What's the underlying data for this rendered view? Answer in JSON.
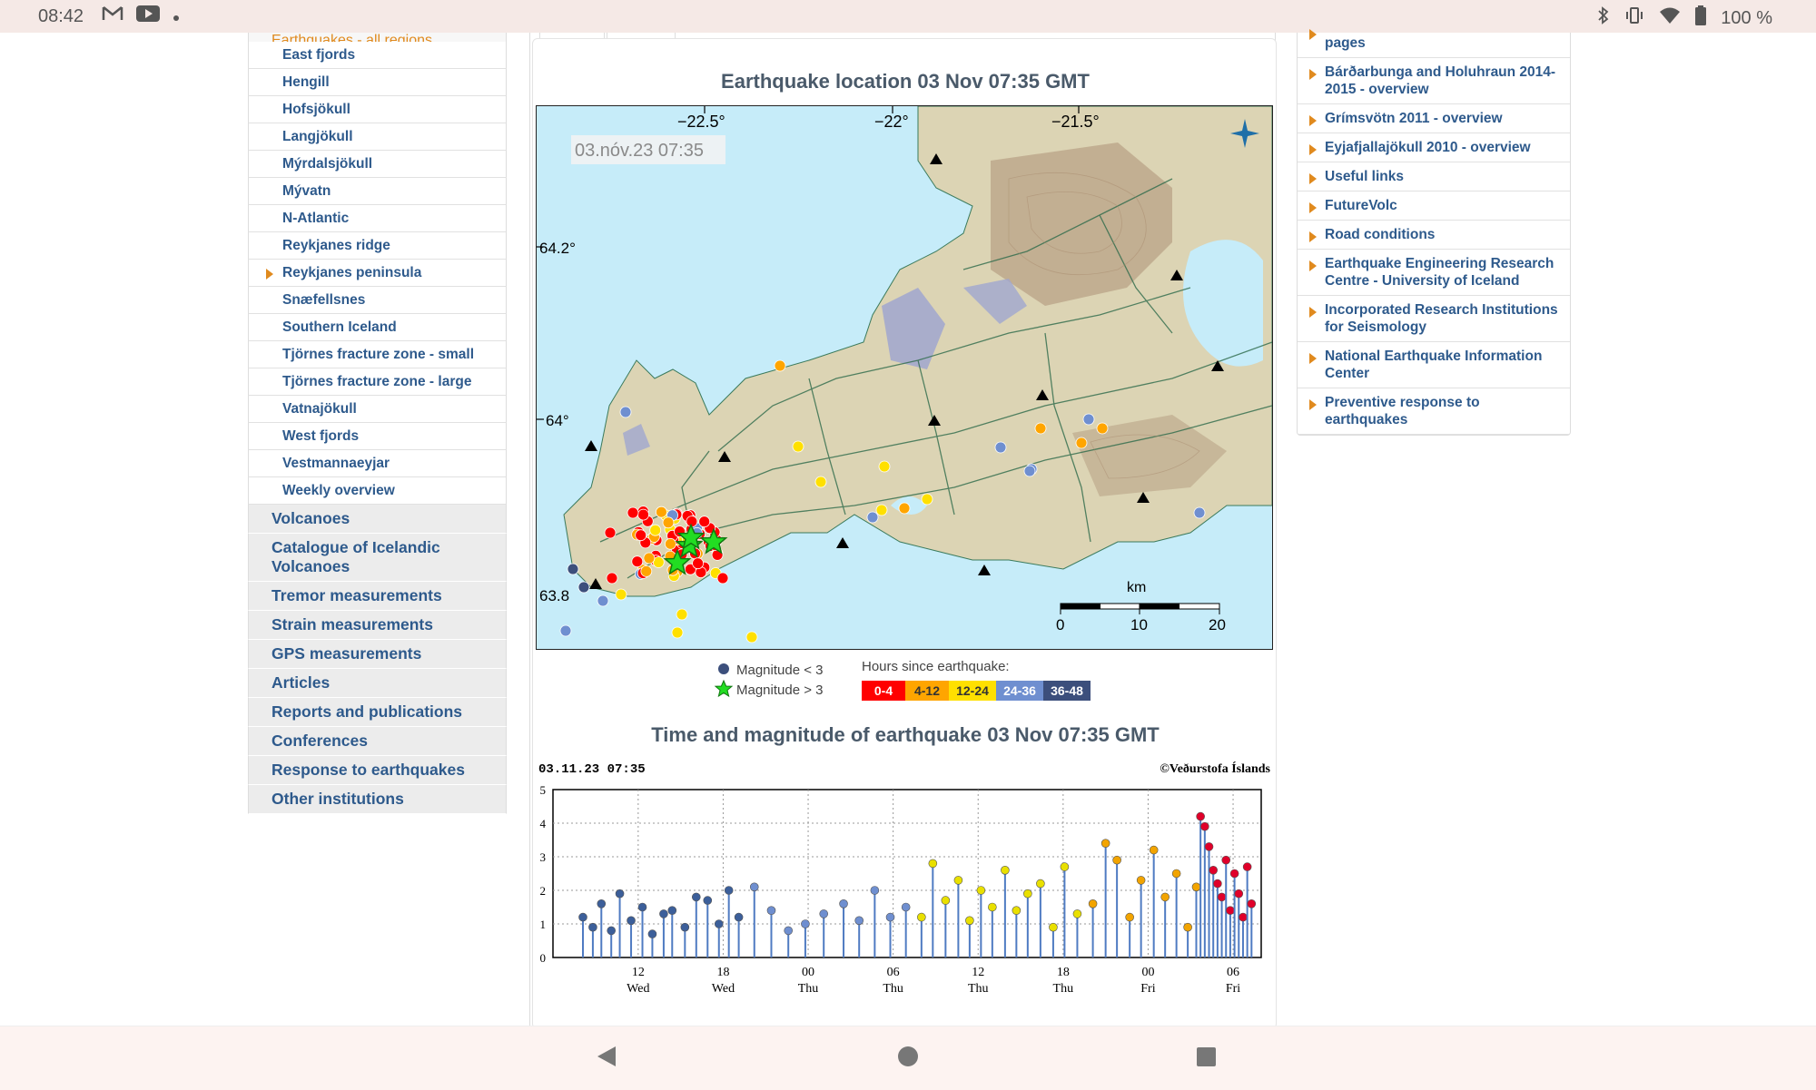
{
  "status_bar": {
    "time": "08:42",
    "left_icons": [
      "gmail-icon",
      "youtube-icon",
      "dot-icon"
    ],
    "right_icons": [
      "bluetooth-icon",
      "vibrate-icon",
      "wifi-icon",
      "battery-icon"
    ],
    "battery": "100 %"
  },
  "left_sidebar": {
    "cut_item": "Earthquakes - all regions",
    "region_items": [
      {
        "label": "East fjords",
        "active": false
      },
      {
        "label": "Hengill",
        "active": false
      },
      {
        "label": "Hofsjökull",
        "active": false
      },
      {
        "label": "Langjökull",
        "active": false
      },
      {
        "label": "Mýrdalsjökull",
        "active": false
      },
      {
        "label": "Mývatn",
        "active": false
      },
      {
        "label": "N-Atlantic",
        "active": false
      },
      {
        "label": "Reykjanes ridge",
        "active": false
      },
      {
        "label": "Reykjanes peninsula",
        "active": true
      },
      {
        "label": "Snæfellsnes",
        "active": false
      },
      {
        "label": "Southern Iceland",
        "active": false
      },
      {
        "label": "Tjörnes fracture zone - small",
        "active": false
      },
      {
        "label": "Tjörnes fracture zone - large",
        "active": false
      },
      {
        "label": "Vatnajökull",
        "active": false
      },
      {
        "label": "West fjords",
        "active": false
      },
      {
        "label": "Vestmannaeyjar",
        "active": false
      },
      {
        "label": "Weekly overview",
        "active": false
      }
    ],
    "main_items": [
      "Volcanoes",
      "Catalogue of Icelandic Volcanoes",
      "Tremor measurements",
      "Strain measurements",
      "GPS measurements",
      "Articles",
      "Reports and publications",
      "Conferences",
      "Response to earthquakes",
      "Other institutions"
    ]
  },
  "map_section": {
    "title": "Earthquake location   03 Nov 07:35 GMT",
    "timestamp": "03.nóv.23  07:35",
    "lon_ticks": [
      "−22.5°",
      "−22°",
      "−21.5°"
    ],
    "lat_ticks": [
      "64.2°",
      "64°",
      "63.8"
    ],
    "scale_unit": "km",
    "scale_ticks": [
      "0",
      "10",
      "20"
    ],
    "legend_small": "Magnitude < 3",
    "legend_large": "Magnitude > 3",
    "hours_label": "Hours since earthquake:",
    "hour_bins": [
      {
        "label": "0-4",
        "color": "#ff0000"
      },
      {
        "label": "4-12",
        "color": "#ffa500"
      },
      {
        "label": "12-24",
        "color": "#ffe000"
      },
      {
        "label": "24-36",
        "color": "#6f8fd0"
      },
      {
        "label": "36-48",
        "color": "#3c4f7c"
      }
    ]
  },
  "plot_section": {
    "title": "Time and magnitude of earthquake   03 Nov 07:35 GMT",
    "timestamp": "03.11.23 07:35",
    "credit": "©Veðurstofa Íslands"
  },
  "chart_data": {
    "type": "scatter",
    "title": "Time and magnitude of earthquake   03 Nov 07:35 GMT",
    "xlabel": "",
    "ylabel": "",
    "ylim": [
      0,
      5
    ],
    "y_ticks": [
      "0",
      "1",
      "2",
      "3",
      "4",
      "5"
    ],
    "x_ticks": [
      {
        "hour": "12",
        "day": "Wed"
      },
      {
        "hour": "18",
        "day": "Wed"
      },
      {
        "hour": "00",
        "day": "Thu"
      },
      {
        "hour": "06",
        "day": "Thu"
      },
      {
        "hour": "12",
        "day": "Thu"
      },
      {
        "hour": "18",
        "day": "Thu"
      },
      {
        "hour": "00",
        "day": "Fri"
      },
      {
        "hour": "06",
        "day": "Fri"
      }
    ],
    "grid": true,
    "series": [
      {
        "color": "#3c5f9a",
        "hours_before_end": [
          47.5,
          46.8,
          46.2,
          45.5,
          44.9,
          44.1,
          43.3,
          42.6,
          41.8,
          41.2,
          40.3,
          39.5,
          38.7,
          37.9,
          37.2,
          36.5
        ],
        "magnitudes": [
          1.2,
          0.9,
          1.6,
          0.8,
          1.9,
          1.1,
          1.5,
          0.7,
          1.3,
          1.4,
          0.9,
          1.8,
          1.7,
          1.0,
          2.0,
          1.2
        ]
      },
      {
        "color": "#6f8fd0",
        "hours_before_end": [
          35.4,
          34.2,
          33.0,
          31.8,
          30.5,
          29.1,
          28.0,
          26.9,
          25.8,
          24.7
        ],
        "magnitudes": [
          2.1,
          1.4,
          0.8,
          1.0,
          1.3,
          1.6,
          1.1,
          2.0,
          1.2,
          1.5
        ]
      },
      {
        "color": "#e9e000",
        "hours_before_end": [
          23.6,
          22.8,
          21.9,
          21.0,
          20.2,
          19.4,
          18.6,
          17.7,
          16.9,
          16.1,
          15.2,
          14.3,
          13.5,
          12.6
        ],
        "magnitudes": [
          1.2,
          2.8,
          1.7,
          2.3,
          1.1,
          2.0,
          1.5,
          2.6,
          1.4,
          1.9,
          2.2,
          0.9,
          2.7,
          1.3
        ]
      },
      {
        "color": "#f2a400",
        "hours_before_end": [
          11.5,
          10.6,
          9.8,
          8.9,
          8.1,
          7.2,
          6.4,
          5.6,
          4.8,
          4.2
        ],
        "magnitudes": [
          1.6,
          3.4,
          2.9,
          1.2,
          2.3,
          3.2,
          1.8,
          2.5,
          0.9,
          2.1
        ]
      },
      {
        "color": "#e0002a",
        "hours_before_end": [
          3.9,
          3.6,
          3.3,
          3.0,
          2.7,
          2.4,
          2.1,
          1.8,
          1.5,
          1.2,
          0.9,
          0.6,
          0.3
        ],
        "magnitudes": [
          4.2,
          3.9,
          3.3,
          2.6,
          2.2,
          1.8,
          2.9,
          1.4,
          2.5,
          1.9,
          1.2,
          2.7,
          1.6
        ]
      }
    ]
  },
  "right_sidebar": {
    "items": [
      "pages",
      "Bárðarbunga and Holuhraun 2014-2015 - overview",
      "Grímsvötn 2011 - overview",
      "Eyjafjallajökull 2010 - overview",
      "Useful links",
      "FutureVolc",
      "Road conditions",
      "Earthquake Engineering Research Centre - University of Iceland",
      "Incorporated Research Institutions for Seismology",
      "National Earthquake Information Center",
      "Preventive response to earthquakes"
    ]
  },
  "nav_bar": {
    "icons": [
      "back-icon",
      "home-icon",
      "recents-icon"
    ]
  }
}
